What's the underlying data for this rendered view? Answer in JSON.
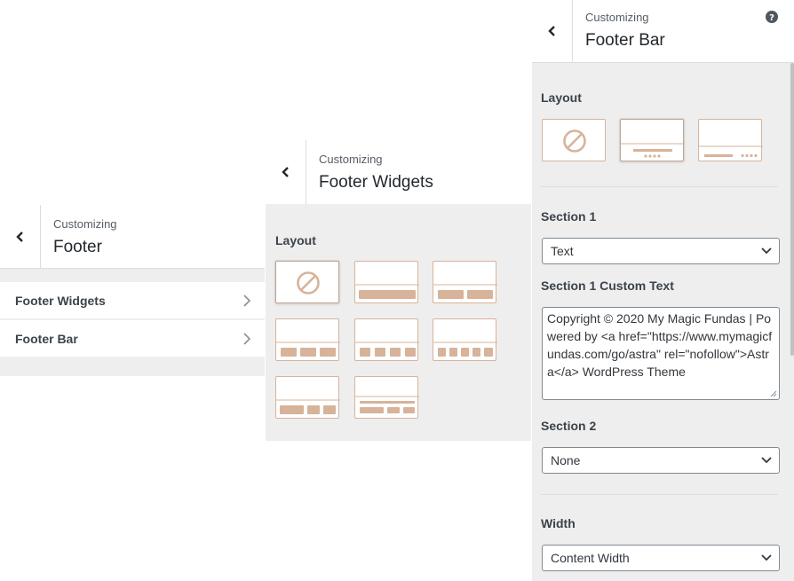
{
  "footer_panel": {
    "header": {
      "sub": "Customizing",
      "title": "Footer"
    },
    "items": [
      {
        "label": "Footer Widgets"
      },
      {
        "label": "Footer Bar"
      }
    ]
  },
  "widgets_panel": {
    "header": {
      "sub": "Customizing",
      "title": "Footer Widgets"
    },
    "layout_label": "Layout"
  },
  "bar_panel": {
    "header": {
      "sub": "Customizing",
      "title": "Footer Bar"
    },
    "help_icon": "question-circle-icon",
    "layout_label": "Layout",
    "section1_label": "Section 1",
    "section1_value": "Text",
    "custom_text_label": "Section 1 Custom Text",
    "custom_text": "Copyright © 2020 My Magic Fundas | Powered by <a href=\"https://www.mymagicfundas.com/go/astra\" rel=\"nofollow\">Astra</a> WordPress Theme",
    "section2_label": "Section 2",
    "section2_value": "None",
    "width_label": "Width",
    "width_value": "Content Width"
  },
  "colors": {
    "accent": "#d7b39a",
    "panel_bg": "#eeeeee",
    "border": "#dddddd"
  }
}
